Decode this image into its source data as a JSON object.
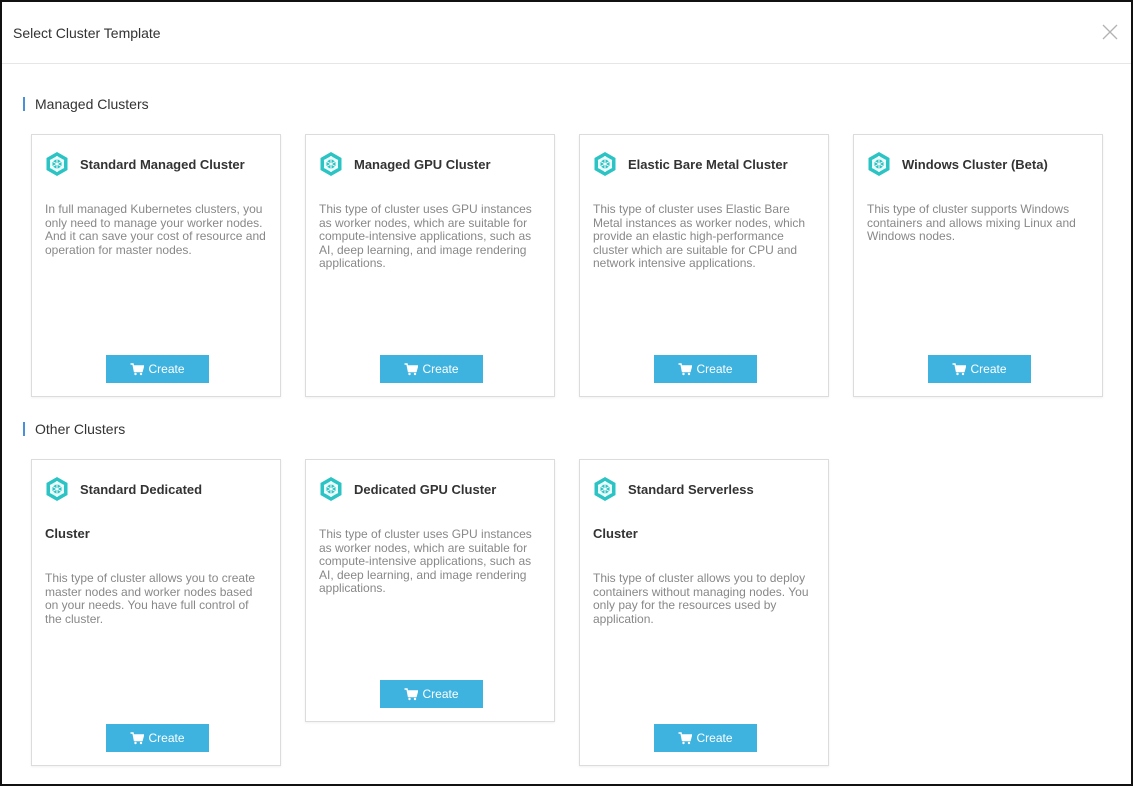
{
  "dialog": {
    "title": "Select Cluster Template"
  },
  "sections": {
    "managed": {
      "title": "Managed Clusters"
    },
    "other": {
      "title": "Other Clusters"
    }
  },
  "create_label": "Create",
  "cards": {
    "standard_managed": {
      "title": "Standard Managed Cluster",
      "description": "In full managed Kubernetes clusters, you only need to manage your worker nodes. And it can save your cost of resource and operation for master nodes."
    },
    "managed_gpu": {
      "title": "Managed GPU Cluster",
      "description": "This type of cluster uses GPU instances as worker nodes, which are suitable for compute-intensive applications, such as AI, deep learning, and image rendering applications."
    },
    "elastic_bare_metal": {
      "title": "Elastic Bare Metal Cluster",
      "description": "This type of cluster uses Elastic Bare Metal instances as worker nodes, which provide an elastic high-performance cluster which are suitable for CPU and network intensive applications."
    },
    "windows": {
      "title": "Windows Cluster (Beta)",
      "description": "This type of cluster supports Windows containers and allows mixing Linux and Windows nodes."
    },
    "standard_dedicated": {
      "title_line1": "Standard Dedicated",
      "title_line2": "Cluster",
      "description": "This type of cluster allows you to create master nodes and worker nodes based on your needs. You have full control of the cluster."
    },
    "dedicated_gpu": {
      "title": "Dedicated GPU Cluster",
      "description": "This type of cluster uses GPU instances as worker nodes, which are suitable for compute-intensive applications, such as AI, deep learning, and image rendering applications."
    },
    "standard_serverless": {
      "title_line1": "Standard Serverless",
      "title_line2": "Cluster",
      "description": "This type of cluster allows you to deploy containers without managing nodes. You only pay for the resources used by application."
    }
  },
  "colors": {
    "accent": "#3fb3e0",
    "section_marker": "#4a90d9",
    "icon_teal": "#2bc3c3"
  },
  "icons": {
    "card": "kubernetes-hexagon-icon",
    "button": "cart-icon",
    "close": "close-icon"
  }
}
